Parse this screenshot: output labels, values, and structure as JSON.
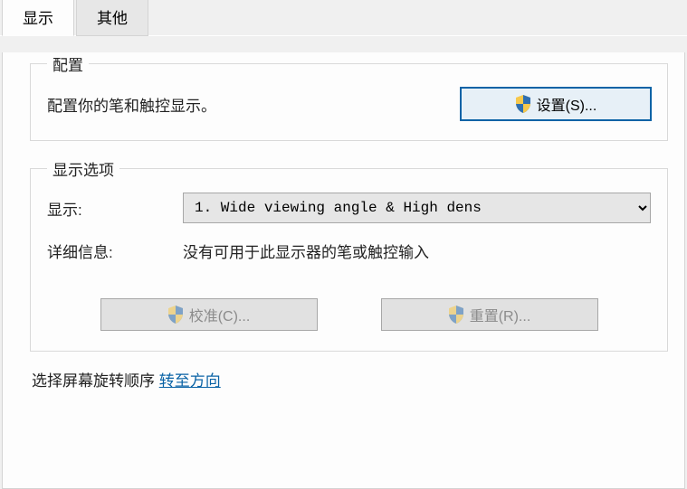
{
  "tabs": {
    "display": "显示",
    "other": "其他"
  },
  "config_group": {
    "legend": "配置",
    "text": "配置你的笔和触控显示。",
    "setup_button": "设置(S)..."
  },
  "options_group": {
    "legend": "显示选项",
    "display_label": "显示:",
    "display_selected": "1. Wide viewing angle & High dens",
    "details_label": "详细信息:",
    "details_value": "没有可用于此显示器的笔或触控输入",
    "calibrate_button": "校准(C)...",
    "reset_button": "重置(R)..."
  },
  "rotation": {
    "prefix": "选择屏幕旋转顺序",
    "link": "转至方向"
  }
}
